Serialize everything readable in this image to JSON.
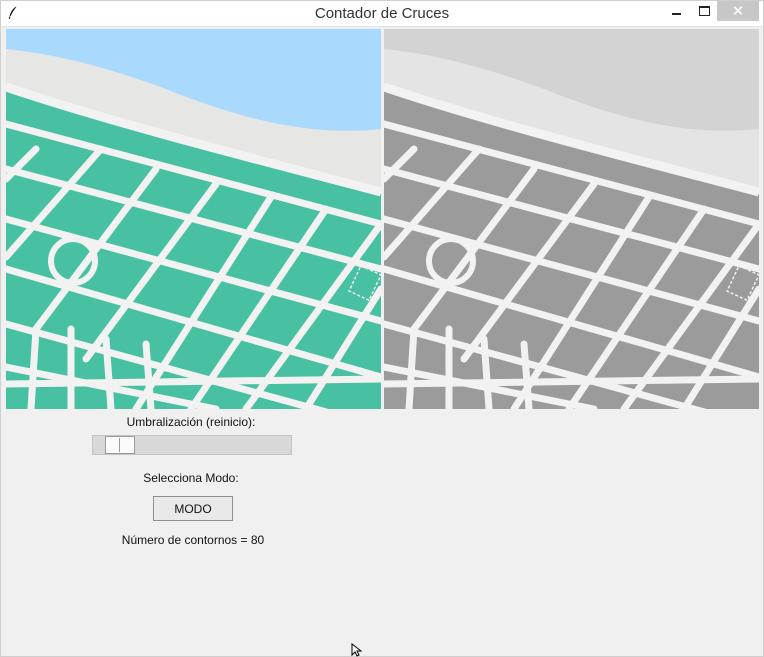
{
  "window": {
    "title": "Contador de Cruces",
    "close_glyph": "✕",
    "app_icon": "feather-icon"
  },
  "colors": {
    "map_block": "#48c1a2",
    "map_water": "#a9dafe",
    "map_beach": "#e6e6e4",
    "road": "#f2f2f2",
    "gray_block": "#9b9b9b",
    "gray_water": "#d3d3d3",
    "gray_beach": "#e4e4e4",
    "close_button": "#c7c7c7"
  },
  "controls": {
    "threshold_label": "Umbralización (reinicio):",
    "threshold_value_fraction": 0.07,
    "mode_label": "Selecciona Modo:",
    "mode_button_label": "MODO",
    "contour_count_text": "Número de contornos = 80"
  }
}
